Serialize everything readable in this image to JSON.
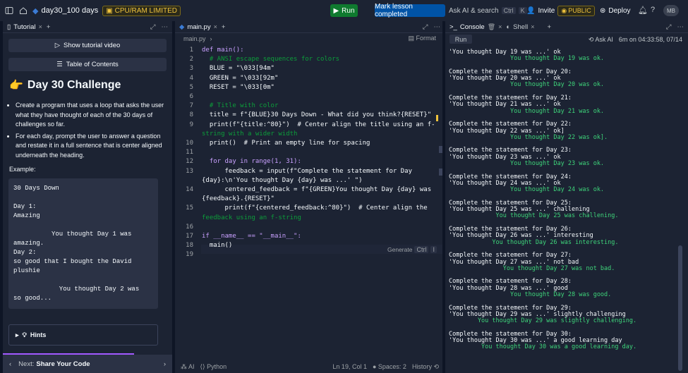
{
  "topbar": {
    "repo_name": "day30_100 days",
    "cpu_badge": "CPU/RAM LIMITED",
    "run_label": "Run",
    "mark_label": "Mark lesson completed",
    "ask_label": "Ask AI & search",
    "ask_kbd1": "Ctrl",
    "ask_kbd2": "K",
    "invite_label": "Invite",
    "public_label": "PUBLIC",
    "deploy_label": "Deploy",
    "avatar": "MB"
  },
  "tutorial": {
    "tab_label": "Tutorial",
    "video_btn": "Show tutorial video",
    "toc_btn": "Table of Contents",
    "title_emoji": "👉",
    "title": "Day 30 Challenge",
    "bullets": [
      "Create a program that uses a loop that asks the user what they have thought of each of the 30 days of challenges so far.",
      "For each day, prompt the user to answer a question and restate it in a full sentence that is center aligned underneath the heading."
    ],
    "example_label": "Example:",
    "example_code": "30 Days Down\n\nDay 1:\nAmazing\n\n          You thought Day 1 was\namazing.\nDay 2:\nso good that I bought the David\nplushie\n\n            You thought Day 2 was\nso good...",
    "hints_label": "Hints",
    "next_prefix": "Next:",
    "next_title": "Share Your Code"
  },
  "editor": {
    "tab_label": "main.py",
    "file_label": "main.py",
    "format_label": "Format",
    "generate_label": "Generate",
    "generate_kbd1": "Ctrl",
    "generate_kbd2": "I",
    "lines": [
      {
        "n": "1",
        "t": "def main():"
      },
      {
        "n": "2",
        "t": "  # ANSI escape sequences for colors"
      },
      {
        "n": "3",
        "t": "  BLUE = \"\\033[94m\""
      },
      {
        "n": "4",
        "t": "  GREEN = \"\\033[92m\""
      },
      {
        "n": "5",
        "t": "  RESET = \"\\033[0m\""
      },
      {
        "n": "6",
        "t": ""
      },
      {
        "n": "7",
        "t": "  # Title with color"
      },
      {
        "n": "8",
        "t": "  title = f\"{BLUE}30 Days Down - What did you think?{RESET}\""
      },
      {
        "n": "9",
        "t": "  print(f\"{title:^80}\")  # Center align the title using an f-"
      },
      {
        "n": "",
        "t": "string with a wider width"
      },
      {
        "n": "10",
        "t": "  print()  # Print an empty line for spacing"
      },
      {
        "n": "11",
        "t": ""
      },
      {
        "n": "12",
        "t": "  for day in range(1, 31):"
      },
      {
        "n": "13",
        "t": "      feedback = input(f\"Complete the statement for Day"
      },
      {
        "n": "",
        "t": "{day}:\\n'You thought Day {day} was ...' \")"
      },
      {
        "n": "14",
        "t": "      centered_feedback = f\"{GREEN}You thought Day {day} was"
      },
      {
        "n": "",
        "t": "{feedback}.{RESET}\""
      },
      {
        "n": "15",
        "t": "      print(f\"{centered_feedback:^80}\")  # Center align the"
      },
      {
        "n": "",
        "t": "feedback using an f-string"
      },
      {
        "n": "16",
        "t": ""
      },
      {
        "n": "17",
        "t": "if __name__ == \"__main__\":"
      },
      {
        "n": "18",
        "t": "  main()"
      },
      {
        "n": "19",
        "t": ""
      }
    ],
    "status_ai": "AI",
    "status_lang": "Python",
    "status_pos": "Ln 19, Col 1",
    "status_spaces": "Spaces: 2",
    "status_history": "History"
  },
  "console": {
    "tab_console": "Console",
    "tab_shell": "Shell",
    "ask_ai": "Ask AI",
    "timestamp": "6m on 04:33:58, 07/14",
    "run_label": "Run",
    "output": [
      {
        "c": "w",
        "t": "'You thought Day 19 was ...' ok"
      },
      {
        "c": "g",
        "t": "                 You thought Day 19 was ok."
      },
      {
        "c": "w",
        "t": ""
      },
      {
        "c": "w",
        "t": "Complete the statement for Day 20:"
      },
      {
        "c": "w",
        "t": "'You thought Day 20 was ...' ok"
      },
      {
        "c": "g",
        "t": "                 You thought Day 20 was ok."
      },
      {
        "c": "w",
        "t": ""
      },
      {
        "c": "w",
        "t": "Complete the statement for Day 21:"
      },
      {
        "c": "w",
        "t": "'You thought Day 21 was ...' ok"
      },
      {
        "c": "g",
        "t": "                 You thought Day 21 was ok."
      },
      {
        "c": "w",
        "t": ""
      },
      {
        "c": "w",
        "t": "Complete the statement for Day 22:"
      },
      {
        "c": "w",
        "t": "'You thought Day 22 was ...' ok]"
      },
      {
        "c": "g",
        "t": "                 You thought Day 22 was ok]."
      },
      {
        "c": "w",
        "t": ""
      },
      {
        "c": "w",
        "t": "Complete the statement for Day 23:"
      },
      {
        "c": "w",
        "t": "'You thought Day 23 was ...' ok"
      },
      {
        "c": "g",
        "t": "                 You thought Day 23 was ok."
      },
      {
        "c": "w",
        "t": ""
      },
      {
        "c": "w",
        "t": "Complete the statement for Day 24:"
      },
      {
        "c": "w",
        "t": "'You thought Day 24 was ...' ok"
      },
      {
        "c": "g",
        "t": "                 You thought Day 24 was ok."
      },
      {
        "c": "w",
        "t": ""
      },
      {
        "c": "w",
        "t": "Complete the statement for Day 25:"
      },
      {
        "c": "w",
        "t": "'You thought Day 25 was ...' challening"
      },
      {
        "c": "g",
        "t": "             You thought Day 25 was challening."
      },
      {
        "c": "w",
        "t": ""
      },
      {
        "c": "w",
        "t": "Complete the statement for Day 26:"
      },
      {
        "c": "w",
        "t": "'You thought Day 26 was ...' interesting"
      },
      {
        "c": "g",
        "t": "            You thought Day 26 was interesting."
      },
      {
        "c": "w",
        "t": ""
      },
      {
        "c": "w",
        "t": "Complete the statement for Day 27:"
      },
      {
        "c": "w",
        "t": "'You thought Day 27 was ...' not bad"
      },
      {
        "c": "g",
        "t": "               You thought Day 27 was not bad."
      },
      {
        "c": "w",
        "t": ""
      },
      {
        "c": "w",
        "t": "Complete the statement for Day 28:"
      },
      {
        "c": "w",
        "t": "'You thought Day 28 was ...' good"
      },
      {
        "c": "g",
        "t": "                 You thought Day 28 was good."
      },
      {
        "c": "w",
        "t": ""
      },
      {
        "c": "w",
        "t": "Complete the statement for Day 29:"
      },
      {
        "c": "w",
        "t": "'You thought Day 29 was ...' slightly challenging"
      },
      {
        "c": "g",
        "t": "        You thought Day 29 was slightly challenging."
      },
      {
        "c": "w",
        "t": ""
      },
      {
        "c": "w",
        "t": "Complete the statement for Day 30:"
      },
      {
        "c": "w",
        "t": "'You thought Day 30 was ...' a good learning day"
      },
      {
        "c": "g",
        "t": "         You thought Day 30 was a good learning day."
      }
    ]
  },
  "colors": {
    "bg": "#0e1525",
    "panel": "#1c2333",
    "run_green": "#0f7a2f",
    "mark_blue": "#0053a6",
    "output_green": "#3ed47a",
    "badge_yellow": "#f0c33c"
  }
}
